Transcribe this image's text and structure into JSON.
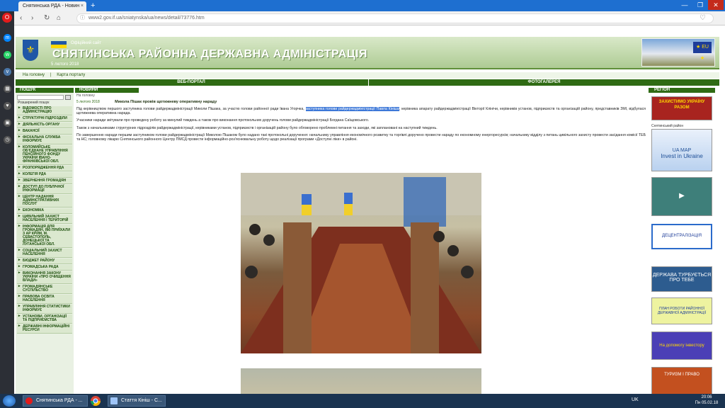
{
  "browser": {
    "tab_title": "Снятинська РДА - Новин",
    "tab_close": "×",
    "new_tab": "+",
    "url": "www2.gov.if.ua/sniatynska/ua/news/detail/73776.htm",
    "win_min": "—",
    "win_max": "❐",
    "win_close": "✕",
    "back": "‹",
    "forward": "›",
    "reload": "↻",
    "home": "⌂",
    "star": "♡",
    "menu": "⋮"
  },
  "header": {
    "subtitle": "Офіційний сайт",
    "title": "СНЯТИНСЬКА РАЙОННА ДЕРЖАВНА АДМІНІСТРАЦІЯ",
    "date": "5 лютого 2018",
    "eu": "★ EU ★"
  },
  "crumbs": [
    "На головну",
    "Карта порталу"
  ],
  "sections": {
    "portal": "ВЕБ-ПОРТАЛ",
    "gallery": "ФОТОГАЛЕРЕЯ"
  },
  "left": {
    "search_title": "ПОШУК",
    "advanced_search": "Розширений пошук",
    "menu": [
      "Відомості про адміністрацію",
      "Структурні підрозділи",
      "Діяльність органу",
      "Вакансії",
      "Фіскальна служба інформує",
      "Коломийське об'єднане управління Пенсійного фонду України Івано-Франківської обл.",
      "Розпорядження РДА",
      "Колегія РДА",
      "Звернення громадян",
      "Доступ до публічної інформації",
      "Центр надання адміністративних послуг",
      "Економіка",
      "Цивільний захист населення і територій",
      "Інформація для громадян, які приїхали з АР Крим, м. Севастополь, Донецької та Луганської обл.",
      "Соціальний захист населення",
      "Бюджет району",
      "Громадська рада",
      "Виконання Закону України «Про очищення влади»",
      "Громадянське суспільство",
      "Правова освіта населення",
      "Управління статистики інформує",
      "Установи, організації та підприємства",
      "Державні інформаційні ресурси"
    ]
  },
  "news": {
    "section": "НОВИНИ",
    "crumb": "На головну",
    "date": "5 лютого 2018",
    "headline": "Микола Пішак провів щотижневу оперативну нараду",
    "p1a": "Під керівництвом першого заступника голови райдержадміністрації Миколи Пішака, за участю голови районної ради Івана Угорчка, ",
    "p1hl": "заступника голови райдержадміністрації Павла Кініша",
    "p1b": ", керівника апарату райдержадміністрації Вікторії Клінічи, керівників установ, підприємств та організацій району, представників ЗМІ, відбулася щотижнева оперативна нарада.",
    "p2": "Учасники наради звітували про проведену роботу за минулий тиждень а також про виконання протокольних доручень голови райдержадміністрації Богдана Саїщовського.",
    "p3": "Також з начальниками структурних підрозділів райдержадміністрації, керівниками установ, підприємств і організацій району було обговорено проблемні питання та заходи, які заплановані на наступний тиждень.",
    "p4": "По завершенню наради першим заступником голови райдержадміністрації Миколою Пішаком було надано такі протокольні доручення: начальнику управління економічного розвитку та торгівлі доручено провести нараду по економному енергоресурсів; начальнику відділу з питань цивільного захисту провести засідання комісії ТЕБ та НС; головному лікарю Снятинського районного Центру ПМСД провести інформаційно-роз'яснювальну роботу щодо реалізації програми «Доступні ліки» в районі."
  },
  "right": {
    "title": "РЕГІОН",
    "defend": "ЗАХИСТИМО УКРАЇНУ РАЗОМ",
    "label": "Снятинський район",
    "invest_top": "UA MAP",
    "invest": "Invest in Ukraine",
    "reform": "▶",
    "decent": "ДЕЦЕНТРАЛІЗАЦІЯ",
    "state": "ДЕРЖАВА ТУРБУЄТЬСЯ ПРО ТЕБЕ",
    "plan": "ПЛАН РОБОТИ РАЙОННОЇ ДЕРЖАВНОЇ АДМІНІСТРАЦІЇ",
    "investor": "На допомогу інвестору",
    "tourism": "ТУРИЗМ І ПРАВО"
  },
  "taskbar": {
    "item1": "Снятинська РДА - ...",
    "item2": "Стаття Кініш - С...",
    "lang": "UK",
    "time": "20:06",
    "date": "Пн 05.02.18"
  }
}
